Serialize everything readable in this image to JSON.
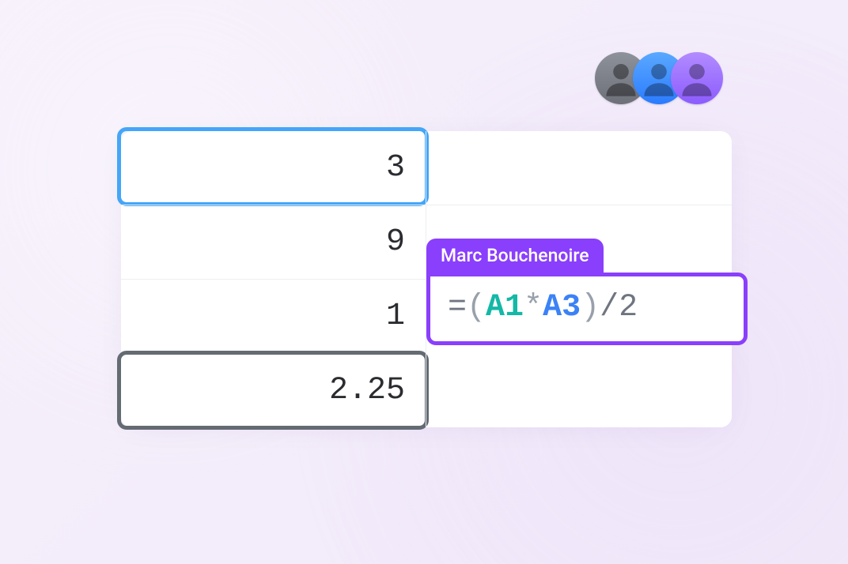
{
  "presence": {
    "users": [
      {
        "color": "gray"
      },
      {
        "color": "blue"
      },
      {
        "color": "purple"
      }
    ]
  },
  "sheet": {
    "a1": "3",
    "a2": "9",
    "a3": "1",
    "a4": "2.25"
  },
  "collab": {
    "user_name": "Marc Bouchenoire",
    "formula": {
      "eq": "=",
      "lp": "(",
      "ref1": "A1",
      "op": "*",
      "ref2": "A3",
      "rp": ")",
      "div": "/",
      "n": "2"
    }
  },
  "colors": {
    "selection_blue": "#44a6f8",
    "selection_gray": "#5b5f66",
    "accent_purple": "#8a3ffc",
    "ref_teal": "#14b8a6",
    "ref_blue": "#3b82f6"
  }
}
